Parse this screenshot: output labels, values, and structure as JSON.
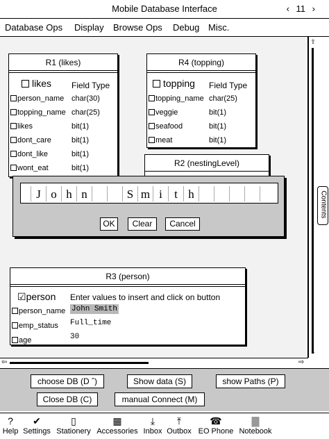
{
  "window": {
    "title": "Mobile Database Interface",
    "prev_symbol": "‹",
    "page_number": "11",
    "next_symbol": "›"
  },
  "menu": [
    "Database Ops",
    "Display",
    "Browse Ops",
    "Debug",
    "Misc."
  ],
  "tables": {
    "r1": {
      "title": "R1 (likes)",
      "select_label": "likes",
      "type_header": "Field Type",
      "fields": [
        {
          "name": "person_name",
          "type": "char(30)"
        },
        {
          "name": "topping_name",
          "type": "char(25)"
        },
        {
          "name": "likes",
          "type": "bit(1)"
        },
        {
          "name": "dont_care",
          "type": "bit(1)"
        },
        {
          "name": "dont_like",
          "type": "bit(1)"
        },
        {
          "name": "wont_eat",
          "type": "bit(1)"
        }
      ]
    },
    "r4": {
      "title": "R4 (topping)",
      "select_label": "topping",
      "type_header": "Field Type",
      "fields": [
        {
          "name": "topping_name",
          "type": "char(25)"
        },
        {
          "name": "veggie",
          "type": "bit(1)"
        },
        {
          "name": "seafood",
          "type": "bit(1)"
        },
        {
          "name": "meat",
          "type": "bit(1)"
        }
      ]
    },
    "r2": {
      "title": "R2 (nestingLevel)"
    },
    "r3": {
      "title": "R3 (person)",
      "check_mark": "☑",
      "select_label": "person",
      "instruction": "Enter values to insert and click on button",
      "fields": [
        {
          "name": "person_name",
          "value": "John Smith"
        },
        {
          "name": "emp_status",
          "value": "Full_time"
        },
        {
          "name": "age",
          "value": "30"
        }
      ]
    }
  },
  "entry_dialog": {
    "chars": [
      "J",
      "o",
      "h",
      "n",
      "",
      "S",
      "m",
      "i",
      "t",
      "h"
    ],
    "ok_label": "OK",
    "clear_label": "Clear",
    "cancel_label": "Cancel"
  },
  "scroll": {
    "up": "⇧",
    "down": "⇩",
    "left": "⇦",
    "right": "⇨"
  },
  "contents_tab": "Contents",
  "buttons": {
    "choose_db": "choose DB (D ˆ)",
    "show_data": "Show data (S)",
    "show_paths": "show Paths (P)",
    "close_db": "Close DB (C)",
    "manual_connect": "manual Connect (M)"
  },
  "dock": [
    {
      "label": "Help",
      "icon": "?"
    },
    {
      "label": "Settings",
      "icon": "✔"
    },
    {
      "label": "Stationery",
      "icon": "▯"
    },
    {
      "label": "Accessories",
      "icon": "▦"
    },
    {
      "label": "Inbox",
      "icon": "⤓"
    },
    {
      "label": "Outbox",
      "icon": "⤒"
    },
    {
      "label": "EO Phone",
      "icon": "☎"
    },
    {
      "label": "Notebook",
      "icon": "▇"
    }
  ]
}
